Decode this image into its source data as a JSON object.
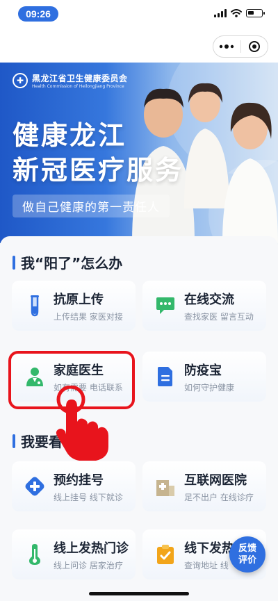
{
  "status_bar": {
    "time": "09:26"
  },
  "banner": {
    "org_cn": "黑龙江省卫生健康委员会",
    "org_en": "Health Commission of Heilongjiang Province",
    "title_line1": "健康龙江",
    "title_line2": "新冠医疗服务",
    "slogan": "做自己健康的第一责任人"
  },
  "section1": {
    "title": "我“阳了”怎么办",
    "cards": [
      {
        "title": "抗原上传",
        "subtitle": "上传结果 家医对接",
        "icon": "test-tube-icon",
        "color": "#2f6fe0"
      },
      {
        "title": "在线交流",
        "subtitle": "查找家医 留言互动",
        "icon": "chat-bubble-icon",
        "color": "#33b86b"
      },
      {
        "title": "家庭医生",
        "subtitle": "如有需要 电话联系",
        "icon": "doctor-icon",
        "color": "#33b86b"
      },
      {
        "title": "防疫宝",
        "subtitle": "如何守护健康",
        "icon": "document-icon",
        "color": "#2f6fe0"
      }
    ]
  },
  "section2": {
    "title": "我要看",
    "cards": [
      {
        "title": "预约挂号",
        "subtitle": "线上挂号 线下就诊",
        "icon": "plus-cross-icon",
        "color": "#2f6fe0"
      },
      {
        "title": "互联网医院",
        "subtitle": "足不出户 在线诊疗",
        "icon": "hospital-icon",
        "color": "#c6b48f"
      },
      {
        "title": "线上发热门诊",
        "subtitle": "线上问诊 居家治疗",
        "icon": "thermometer-icon",
        "color": "#33b86b"
      },
      {
        "title": "线下发热",
        "subtitle": "查询地址 线",
        "icon": "clipboard-check-icon",
        "color": "#f2a51a"
      }
    ]
  },
  "feedback": {
    "line1": "反馈",
    "line2": "评价"
  }
}
